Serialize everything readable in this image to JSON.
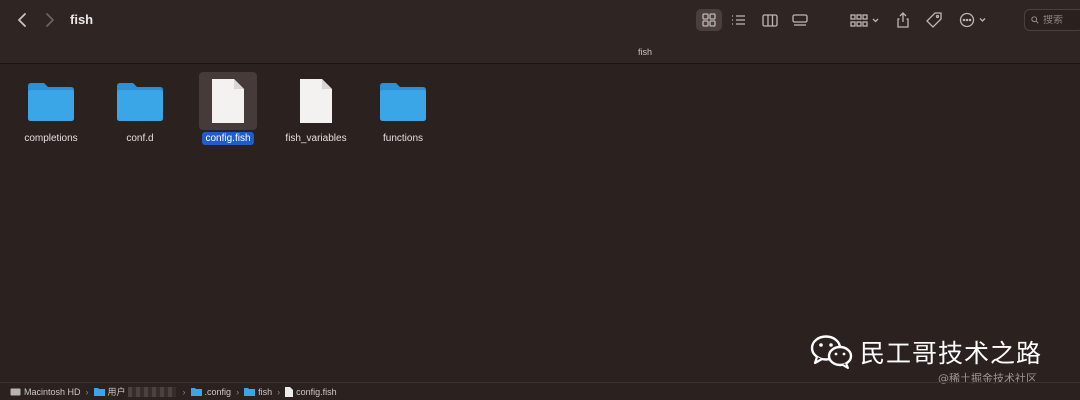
{
  "window": {
    "title": "fish",
    "path_title": "fish"
  },
  "search": {
    "placeholder": "搜索"
  },
  "toolbar_icons": [
    "back-icon",
    "forward-icon",
    "grid-view-icon",
    "list-view-icon",
    "column-view-icon",
    "gallery-view-icon",
    "group-icon",
    "share-icon",
    "tag-icon",
    "more-icon",
    "search-icon"
  ],
  "items": [
    {
      "label": "completions",
      "kind": "folder"
    },
    {
      "label": "conf.d",
      "kind": "folder"
    },
    {
      "label": "config.fish",
      "kind": "file",
      "selected": true
    },
    {
      "label": "fish_variables",
      "kind": "file"
    },
    {
      "label": "functions",
      "kind": "folder"
    }
  ],
  "colors": {
    "folder": "#3aa6e8",
    "selection": "#1f5ccc",
    "background": "#2b211f"
  },
  "watermark": {
    "main": "民工哥技术之路",
    "sub": "@稀土掘金技术社区"
  },
  "pathbar": {
    "disk": "Macintosh HD",
    "users": "用户",
    "config": ".config",
    "fish": "fish",
    "file": "config.fish"
  }
}
